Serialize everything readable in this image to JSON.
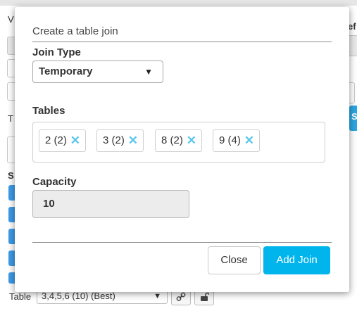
{
  "background": {
    "left_letters": [
      "V",
      "T",
      "S"
    ],
    "right_letters": [
      "ef",
      "S"
    ],
    "bottom_bar": {
      "label": "Table",
      "select_value": "3,4,5,6 (10) (Best)",
      "select_caret": "▼",
      "link_icon": "link-icon",
      "unlock_icon": "unlock-icon"
    }
  },
  "modal": {
    "title": "Create a table join",
    "join_type": {
      "label": "Join Type",
      "value": "Temporary",
      "caret": "▼"
    },
    "tables": {
      "label": "Tables",
      "tags": [
        {
          "text": "2 (2)",
          "remove": "✕"
        },
        {
          "text": "3 (2)",
          "remove": "✕"
        },
        {
          "text": "8 (2)",
          "remove": "✕"
        },
        {
          "text": "9 (4)",
          "remove": "✕"
        }
      ]
    },
    "capacity": {
      "label": "Capacity",
      "value": "10"
    },
    "buttons": {
      "close": "Close",
      "add": "Add Join"
    }
  },
  "colors": {
    "accent": "#00b4ec",
    "tag_remove": "#5bc6ea",
    "background_blue": "#3d9be9"
  }
}
